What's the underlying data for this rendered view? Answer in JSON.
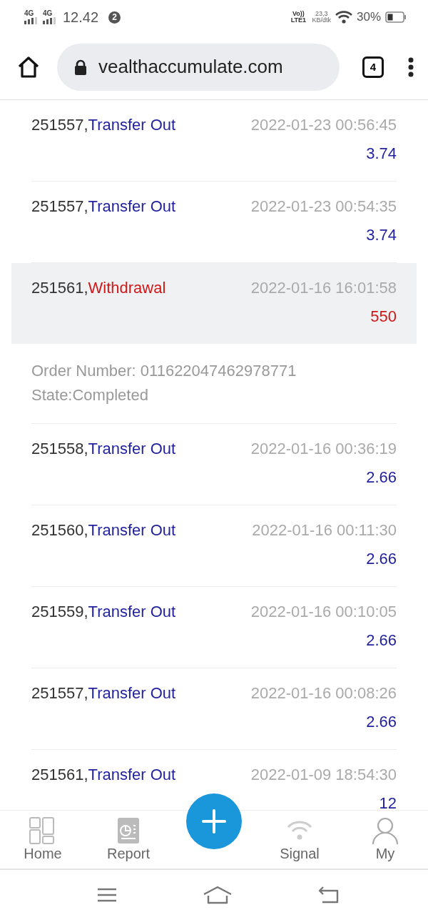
{
  "status_bar": {
    "network_1": "4G",
    "network_2": "4G",
    "time": "12.42",
    "notification_count": "2",
    "volte": "Vo)) LTE1",
    "speed": "23,3",
    "speed_unit": "KB/dtk",
    "battery": "30%"
  },
  "browser": {
    "url": "vealthaccumulate.com",
    "tab_count": "4"
  },
  "records": [
    {
      "id": "251557,",
      "kind": "transfer",
      "type": "Transfer Out",
      "time": "2022-01-23 00:56:45",
      "amount": "3.74",
      "expanded": false
    },
    {
      "id": "251557,",
      "kind": "transfer",
      "type": "Transfer Out",
      "time": "2022-01-23 00:54:35",
      "amount": "3.74",
      "expanded": false
    },
    {
      "id": "251561,",
      "kind": "withdrawal",
      "type": "Withdrawal",
      "time": "2022-01-16 16:01:58",
      "amount": "550",
      "expanded": true,
      "order_number": "Order Number: 011622047462978771",
      "state": "State:Completed"
    },
    {
      "id": "251558,",
      "kind": "transfer",
      "type": "Transfer Out",
      "time": "2022-01-16 00:36:19",
      "amount": "2.66",
      "expanded": false
    },
    {
      "id": "251560,",
      "kind": "transfer",
      "type": "Transfer Out",
      "time": "2022-01-16 00:11:30",
      "amount": "2.66",
      "expanded": false
    },
    {
      "id": "251559,",
      "kind": "transfer",
      "type": "Transfer Out",
      "time": "2022-01-16 00:10:05",
      "amount": "2.66",
      "expanded": false
    },
    {
      "id": "251557,",
      "kind": "transfer",
      "type": "Transfer Out",
      "time": "2022-01-16 00:08:26",
      "amount": "2.66",
      "expanded": false
    },
    {
      "id": "251561,",
      "kind": "transfer",
      "type": "Transfer Out",
      "time": "2022-01-09 18:54:30",
      "amount": "12",
      "expanded": false
    }
  ],
  "bottom_nav": [
    {
      "label": "Home"
    },
    {
      "label": "Report"
    },
    {
      "kind": "add"
    },
    {
      "label": "Signal"
    },
    {
      "label": "My"
    }
  ]
}
